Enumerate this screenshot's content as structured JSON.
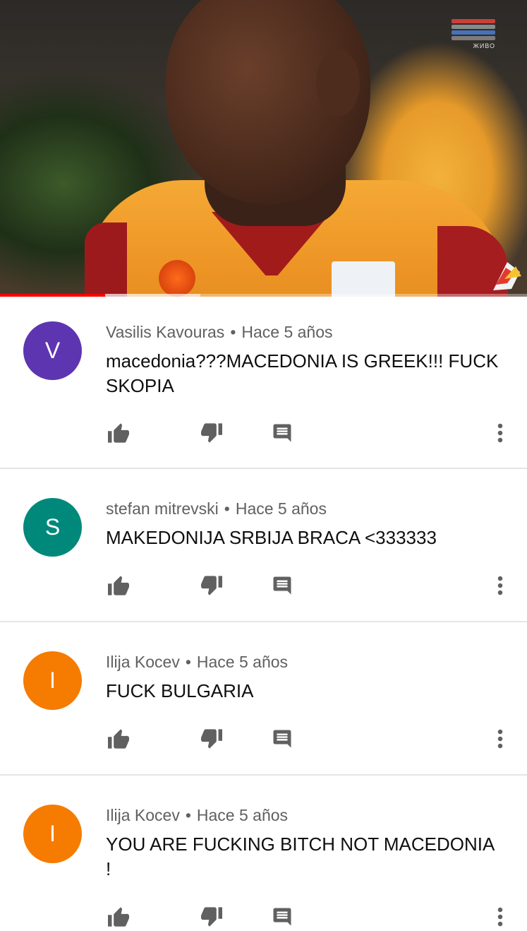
{
  "video": {
    "channel_watermark": "ЖИВО",
    "watermark_colors": [
      "#e8423c",
      "#9a9a9a",
      "#4a7fd1",
      "#8a8a8a",
      "#e23a8a"
    ],
    "progress_played": 0.2,
    "progress_buffered": 0.38,
    "accent_color": "#ff0000"
  },
  "comments": [
    {
      "avatar_letter": "V",
      "avatar_color": "#5e35b1",
      "author": "Vasilis Kavouras",
      "time": "Hace 5 años",
      "text": "macedonia???MACEDONIA IS GREEK!!! FUCK SKOPIA"
    },
    {
      "avatar_letter": "S",
      "avatar_color": "#00897b",
      "author": "stefan mitrevski",
      "time": "Hace 5 años",
      "text": "MAKEDONIJA SRBIJA BRACA <333333"
    },
    {
      "avatar_letter": "I",
      "avatar_color": "#f57c00",
      "author": "Ilija Kocev",
      "time": "Hace 5 años",
      "text": "FUCK BULGARIA"
    },
    {
      "avatar_letter": "I",
      "avatar_color": "#f57c00",
      "author": "Ilija Kocev",
      "time": "Hace 5 años",
      "text": "YOU ARE FUCKING BITCH NOT MACEDONIA !"
    }
  ],
  "icons": {
    "like": "thumb-up-icon",
    "dislike": "thumb-down-icon",
    "reply": "comment-reply-icon",
    "more": "more-vert-icon"
  },
  "meta_separator": "•"
}
